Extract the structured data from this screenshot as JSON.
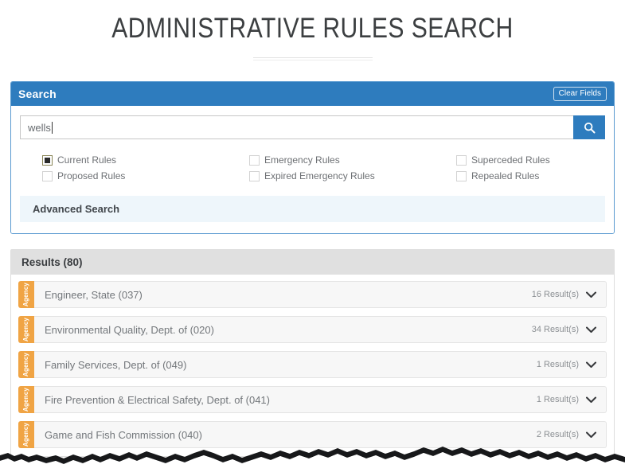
{
  "page": {
    "title": "ADMINISTRATIVE RULES SEARCH"
  },
  "search_panel": {
    "heading": "Search",
    "clear_fields_label": "Clear Fields",
    "search_input": {
      "value": "wells",
      "placeholder": ""
    },
    "search_button_icon": "search-icon",
    "filters": [
      {
        "label": "Current Rules",
        "checked": true
      },
      {
        "label": "Emergency Rules",
        "checked": false
      },
      {
        "label": "Superceded Rules",
        "checked": false
      },
      {
        "label": "Proposed Rules",
        "checked": false
      },
      {
        "label": "Expired Emergency Rules",
        "checked": false
      },
      {
        "label": "Repealed Rules",
        "checked": false
      }
    ],
    "advanced_search_label": "Advanced Search"
  },
  "results_panel": {
    "heading": "Results (80)",
    "total": 80,
    "tab_label": "Agency",
    "rows": [
      {
        "name": "Engineer, State (037)",
        "count_label": "16 Result(s)"
      },
      {
        "name": "Environmental Quality, Dept. of (020)",
        "count_label": "34 Result(s)"
      },
      {
        "name": "Family Services, Dept. of (049)",
        "count_label": "1 Result(s)"
      },
      {
        "name": "Fire Prevention & Electrical Safety, Dept. of (041)",
        "count_label": "1 Result(s)"
      },
      {
        "name": "Game and Fish Commission (040)",
        "count_label": "2 Result(s)"
      }
    ]
  },
  "colors": {
    "header_blue": "#2e7cbe",
    "agency_orange": "#f0a444",
    "results_header_gray": "#e0e0e0",
    "advanced_search_bg": "#eef6fb"
  }
}
